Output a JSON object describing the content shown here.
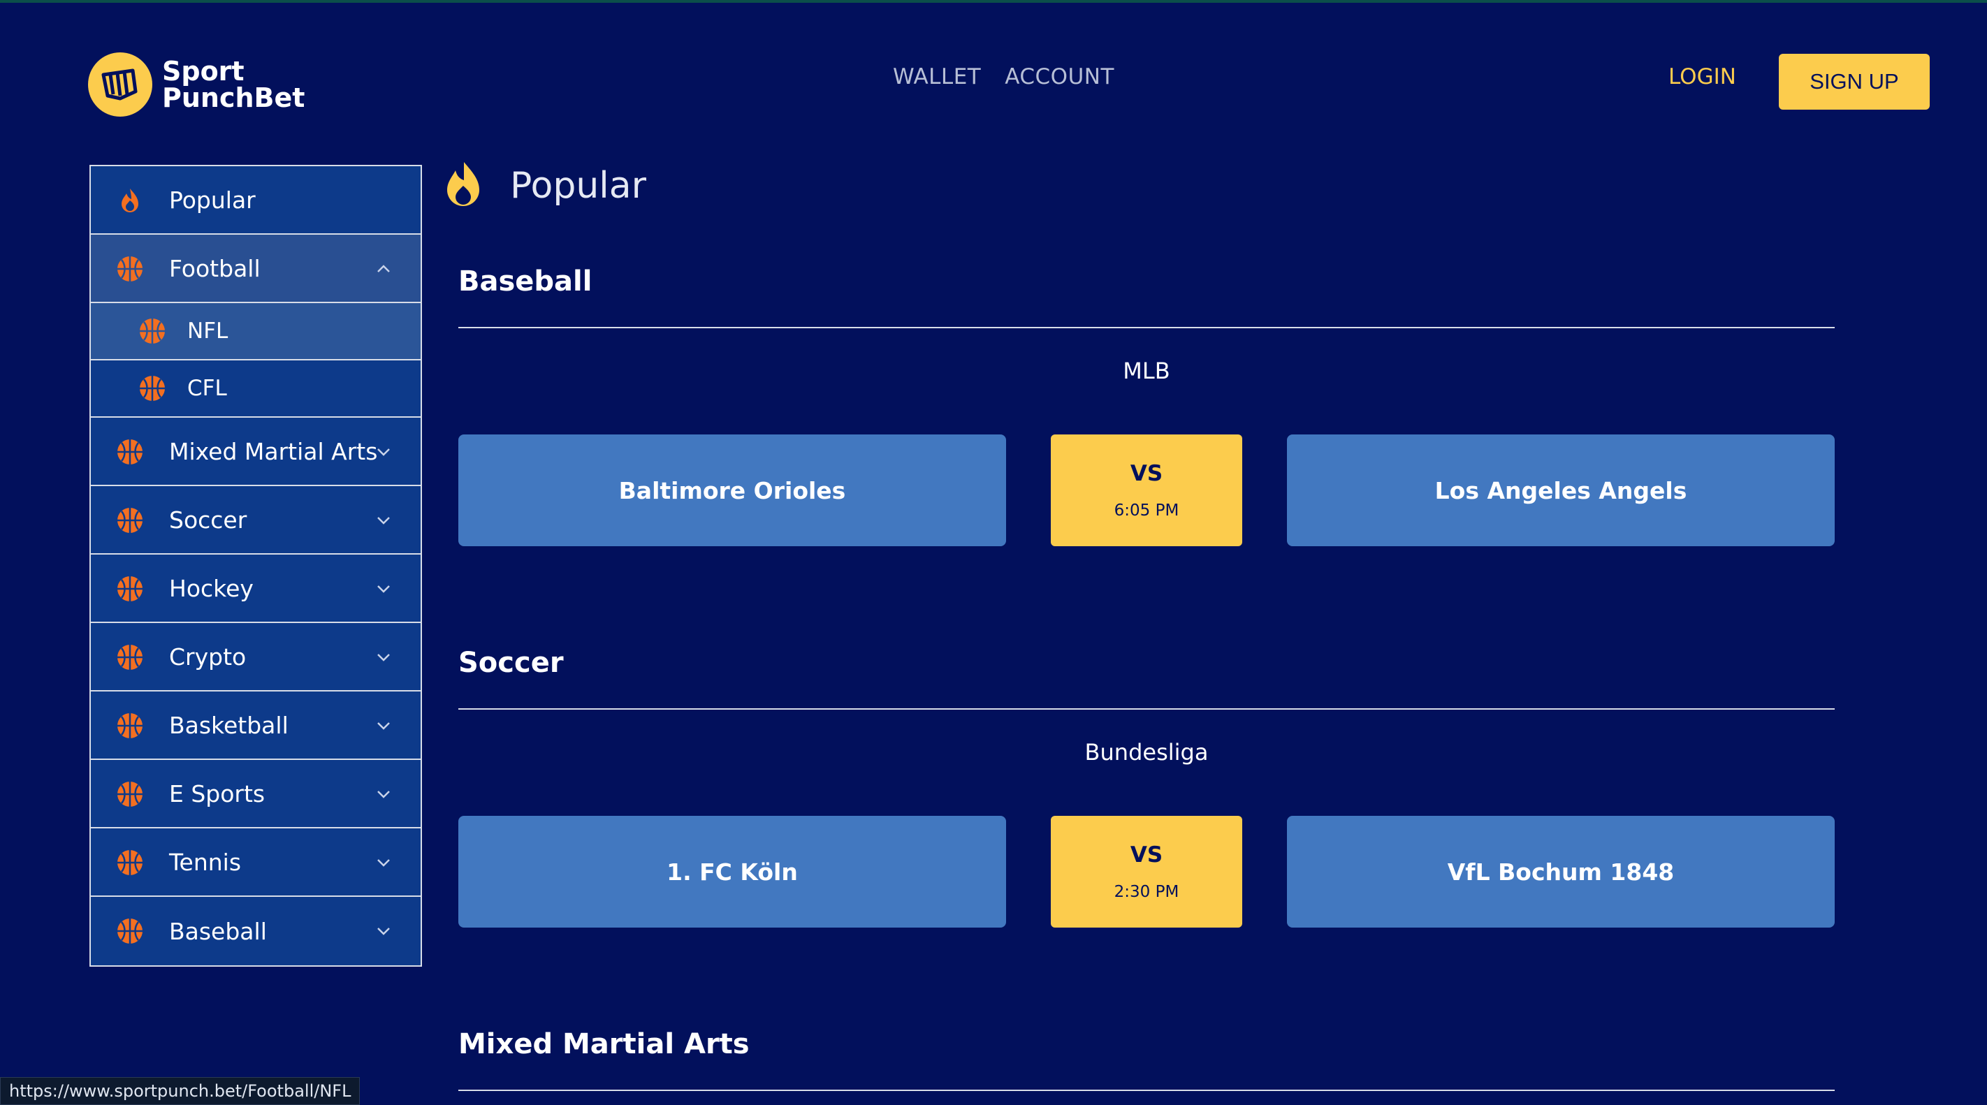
{
  "brand": {
    "line1": "Sport",
    "line2": "PunchBet",
    "colors": {
      "bg": "#02105c",
      "accent": "#fccc4d",
      "card": "#4278c0",
      "sidebar": "#0d3a8a"
    }
  },
  "nav": {
    "wallet": "WALLET",
    "account": "ACCOUNT",
    "login": "LOGIN",
    "signup": "SIGN UP"
  },
  "sidebar": {
    "items": [
      {
        "label": "Popular",
        "icon": "flame-icon"
      },
      {
        "label": "Football",
        "icon": "ball-icon",
        "expanded": true
      },
      {
        "label": "NFL",
        "icon": "ball-icon",
        "sub": true,
        "selected": true
      },
      {
        "label": "CFL",
        "icon": "ball-icon",
        "sub": true
      },
      {
        "label": "Mixed Martial Arts",
        "icon": "ball-icon"
      },
      {
        "label": "Soccer",
        "icon": "ball-icon"
      },
      {
        "label": "Hockey",
        "icon": "ball-icon"
      },
      {
        "label": "Crypto",
        "icon": "ball-icon"
      },
      {
        "label": "Basketball",
        "icon": "ball-icon"
      },
      {
        "label": "E Sports",
        "icon": "ball-icon"
      },
      {
        "label": "Tennis",
        "icon": "ball-icon"
      },
      {
        "label": "Baseball",
        "icon": "ball-icon"
      }
    ]
  },
  "main": {
    "title": "Popular",
    "sections": [
      {
        "title": "Baseball",
        "league": "MLB",
        "home": "Baltimore Orioles",
        "vs": "VS",
        "time": "6:05 PM",
        "away": "Los Angeles Angels"
      },
      {
        "title": "Soccer",
        "league": "Bundesliga",
        "home": "1. FC Köln",
        "vs": "VS",
        "time": "2:30 PM",
        "away": "VfL Bochum 1848"
      },
      {
        "title": "Mixed Martial Arts"
      }
    ]
  },
  "status_url": "https://www.sportpunch.bet/Football/NFL"
}
